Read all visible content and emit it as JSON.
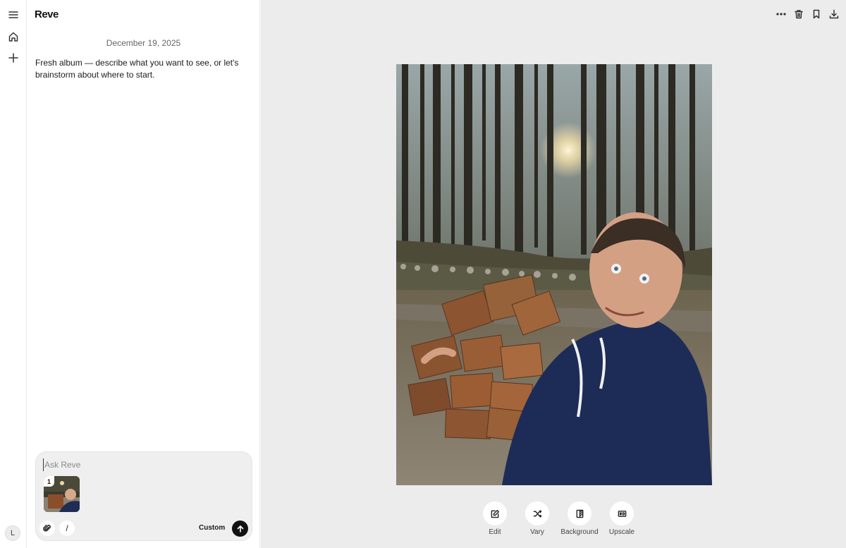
{
  "rail": {
    "avatar_initial": "L"
  },
  "chat": {
    "brand": "Reve",
    "date": "December 19, 2025",
    "message": "Fresh album — describe what you want to see, or let's brainstorm about where to start."
  },
  "composer": {
    "placeholder": "Ask Reve",
    "attachment_index": "1",
    "slash_label": "/",
    "mode_label": "Custom"
  },
  "actions": [
    {
      "label": "Edit",
      "icon": "edit-icon"
    },
    {
      "label": "Vary",
      "icon": "shuffle-icon"
    },
    {
      "label": "Background",
      "icon": "background-icon"
    },
    {
      "label": "Upscale",
      "icon": "upscale-icon"
    }
  ],
  "top_actions": [
    "more-icon",
    "trash-icon",
    "bookmark-icon",
    "download-icon"
  ],
  "colors": {
    "canvas_bg": "#ececec",
    "send_button": "#111111"
  }
}
